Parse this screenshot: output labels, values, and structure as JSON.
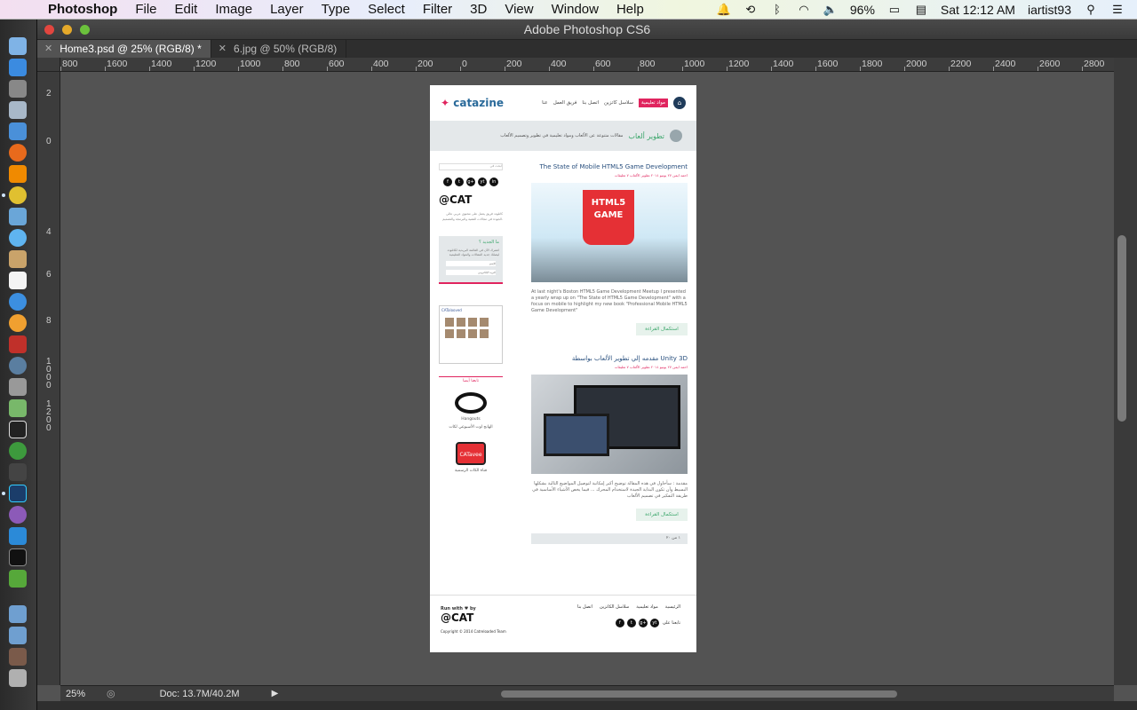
{
  "menubar": {
    "app_name": "Photoshop",
    "items": [
      "File",
      "Edit",
      "Image",
      "Layer",
      "Type",
      "Select",
      "Filter",
      "3D",
      "View",
      "Window",
      "Help"
    ],
    "battery": "96%",
    "clock": "Sat 12:12 AM",
    "user": "iartist93"
  },
  "window": {
    "title": "Adobe Photoshop CS6"
  },
  "tabs": [
    {
      "label": "Home3.psd @ 25% (RGB/8) *"
    },
    {
      "label": "6.jpg @ 50% (RGB/8)"
    }
  ],
  "ruler_h": [
    "800",
    "1600",
    "1400",
    "1200",
    "1000",
    "800",
    "600",
    "400",
    "200",
    "0",
    "200",
    "400",
    "600",
    "800",
    "1000",
    "1200",
    "1400",
    "1600",
    "1800",
    "2000",
    "2200",
    "2400",
    "2600",
    "2800"
  ],
  "ruler_v": [
    "2",
    "0",
    "4",
    "6",
    "8",
    "1000",
    "1200"
  ],
  "status": {
    "zoom": "25%",
    "doc": "Doc: 13.7M/40.2M"
  },
  "document": {
    "logo_text": "catazine",
    "nav": [
      "مواد تعليمية",
      "سلاسل كاتزين",
      "اتصل بنا",
      "فريق العمل",
      "عنا"
    ],
    "category_title": "تطوير ألعاب",
    "category_desc": "مقالات متنوعة عن الألعاب ومواد تعليمية في تطوير وتصميم الألعاب",
    "posts": [
      {
        "title": "The State of Mobile HTML5 Game Development",
        "meta": "احمد ايمن   ٢٧ يونيو ٢٠١٤   تطوير الألعاب   ٧ تعليقات",
        "image_label": "HTML5 GAME",
        "excerpt": "At last night's Boston HTML5 Game Development Meetup I presented a yearly wrap up on \"The State of HTML5 Game Development\" with a focus on mobile to highlight my new book \"Professional Mobile HTML5 Game Development\"",
        "read_more": "استكمال القراءة"
      },
      {
        "title": "مقدمه إلي تطوير الألعاب بواسطة Unity 3D",
        "meta": "احمد ايمن   ٢٧ يونيو ٢٠١٤   تطوير الألعاب   ٧ تعليقات",
        "excerpt": "مقدمة : سأحاول في هذه المقالة توضيح أكبر إمكانية لتوصيل المواضيع التالية بشكلها البسيط وأن تكون البداية الجيدة لاستخدام المحرك ... فيما يخص الأشياء الأساسية في طريقة التفكير في تصميم الألعاب",
        "read_more": "استكمال القراءة"
      }
    ],
    "pager": "١ من ٢٠",
    "sidebar": {
      "search_placeholder": "ابحث في",
      "social": [
        "f",
        "t",
        "g+",
        "yt",
        "in"
      ],
      "cat_logo": "@CAT",
      "about_text": "كاتلودد فريق يعمل على محتوى عربي عالي الجودة في مجالات التقنية والبرمجة والتصميم.",
      "news_title": "ما الجديد ؟",
      "news_text": "اشترك الآن في القائمة البريدية لكاتلودد ليصلك جديد المقالات والمواد التعليمية",
      "name_field": "الإسم",
      "email_field": "البريد الإلكتروني",
      "fb_page": "CATalooved",
      "follow_title": "تابعنا أيضا",
      "hangouts_label": "Hangouts",
      "hangouts_caption": "الهانج اوت الأسبوعي لكات",
      "tv_label": "CATavee",
      "tv_caption": "قناة الكات الرسمية"
    },
    "footer": {
      "run_with": "Run with ♥ by",
      "logo": "@CAT",
      "copyright": "Copyright © 2014 Catreloaded Team",
      "links": [
        "الرئيسية",
        "مواد تعليمية",
        "سلاسل الكاتزين",
        "اتصل بنا"
      ],
      "follow": "تابعنا على"
    }
  }
}
